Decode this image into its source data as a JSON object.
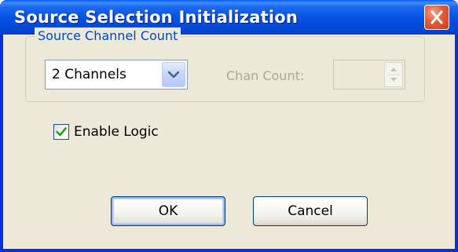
{
  "window": {
    "title": "Source Selection Initialization"
  },
  "group": {
    "legend": "Source Channel Count"
  },
  "channels_select": {
    "selected": "2 Channels"
  },
  "chan_count": {
    "label": "Chan Count:",
    "value": "",
    "enabled": false
  },
  "enable_logic": {
    "label": "Enable Logic",
    "checked": true
  },
  "buttons": {
    "ok": "OK",
    "cancel": "Cancel"
  },
  "icons": {
    "close": "close-icon",
    "dropdown": "chevron-down-icon",
    "spin_up": "spin-up-icon",
    "spin_down": "spin-down-icon",
    "check": "checkmark-icon"
  },
  "colors": {
    "titlebar": "#0652e4",
    "close_button": "#e35a35",
    "group_legend": "#0046d5",
    "dialog_face": "#ece9d8",
    "disabled_text": "#aca899"
  }
}
